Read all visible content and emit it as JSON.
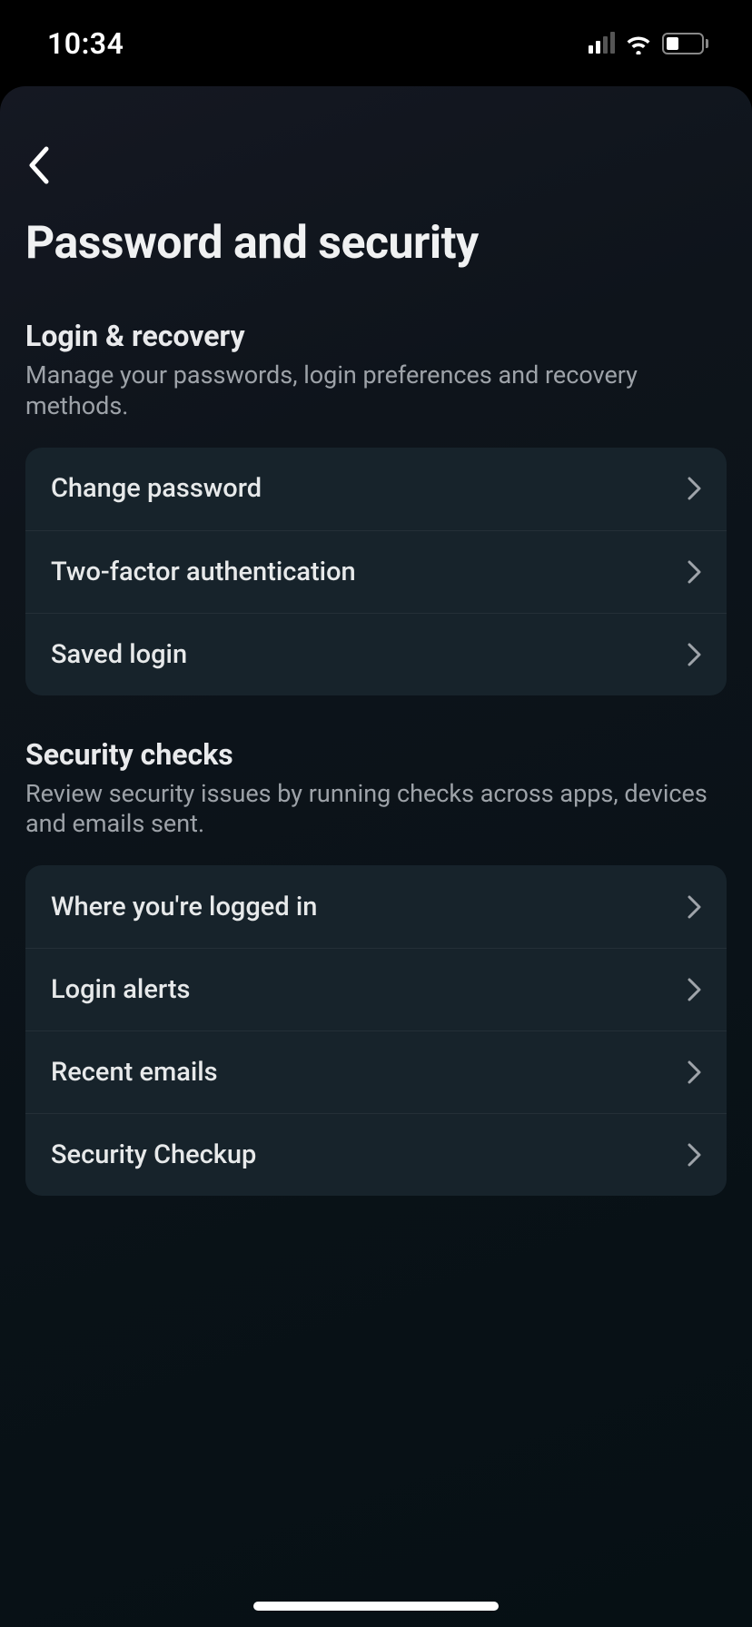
{
  "status_bar": {
    "time": "10:34"
  },
  "page": {
    "title": "Password and security"
  },
  "sections": [
    {
      "title": "Login & recovery",
      "description": "Manage your passwords, login preferences and recovery methods.",
      "items": [
        {
          "label": "Change password"
        },
        {
          "label": "Two-factor authentication"
        },
        {
          "label": "Saved login"
        }
      ]
    },
    {
      "title": "Security checks",
      "description": "Review security issues by running checks across apps, devices and emails sent.",
      "items": [
        {
          "label": "Where you're logged in"
        },
        {
          "label": "Login alerts"
        },
        {
          "label": "Recent emails"
        },
        {
          "label": "Security Checkup"
        }
      ]
    }
  ]
}
